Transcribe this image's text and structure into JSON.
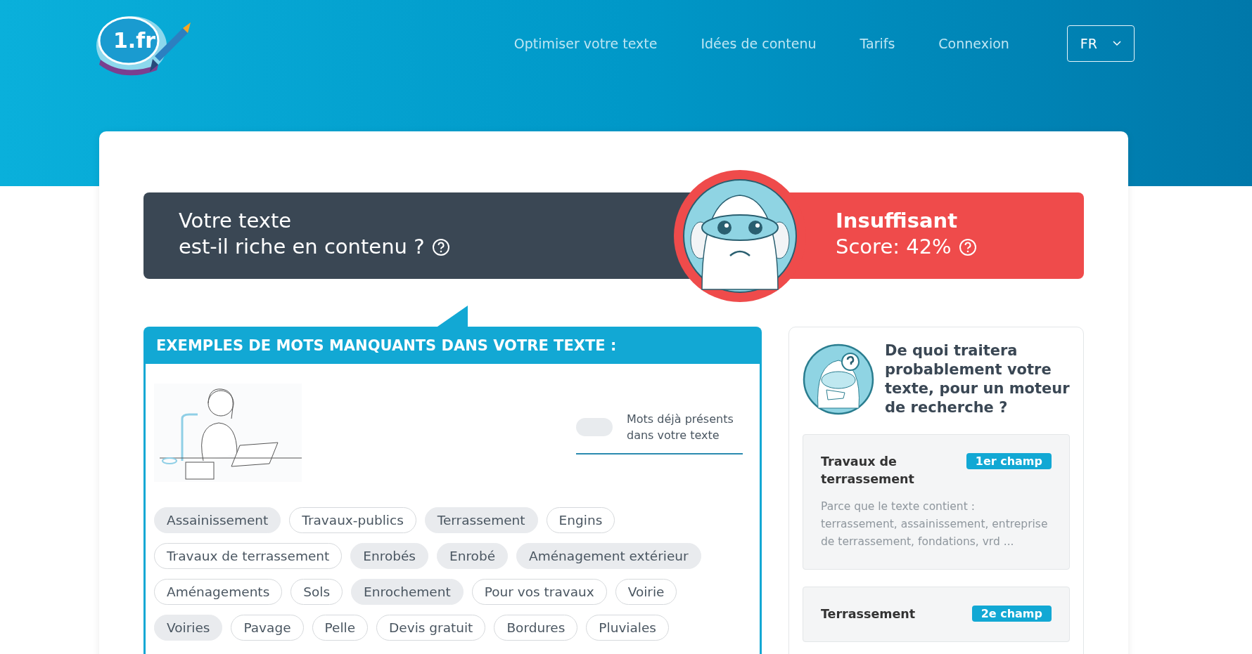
{
  "header": {
    "logo_text": "1.fr",
    "nav": [
      "Optimiser votre texte",
      "Idées de contenu",
      "Tarifs",
      "Connexion"
    ],
    "language": "FR"
  },
  "banner": {
    "question_lines": [
      "Votre texte",
      "est-il riche en contenu ?"
    ],
    "verdict": "Insuffisant",
    "score": "Score: 42%"
  },
  "missing_words": {
    "title": "EXEMPLES DE MOTS MANQUANTS DANS VOTRE TEXTE :",
    "toggle": {
      "label": "Mots déjà présents dans votre texte",
      "on": false
    },
    "tags": [
      {
        "label": "Assainissement",
        "present": true
      },
      {
        "label": "Travaux-publics",
        "present": false
      },
      {
        "label": "Terrassement",
        "present": true
      },
      {
        "label": "Engins",
        "present": false
      },
      {
        "label": "Travaux de terrassement",
        "present": false
      },
      {
        "label": "Enrobés",
        "present": true
      },
      {
        "label": "Enrobé",
        "present": true
      },
      {
        "label": "Aménagement extérieur",
        "present": true
      },
      {
        "label": "Aménagements",
        "present": false
      },
      {
        "label": "Sols",
        "present": false
      },
      {
        "label": "Enrochement",
        "present": true
      },
      {
        "label": "Pour vos travaux",
        "present": false
      },
      {
        "label": "Voirie",
        "present": false
      },
      {
        "label": "Voiries",
        "present": true
      },
      {
        "label": "Pavage",
        "present": false
      },
      {
        "label": "Pelle",
        "present": false
      },
      {
        "label": "Devis gratuit",
        "present": false
      },
      {
        "label": "Bordures",
        "present": false
      },
      {
        "label": "Pluviales",
        "present": false
      }
    ]
  },
  "topics": {
    "title": "De quoi traitera probablement votre texte, pour un moteur de recherche ?",
    "items": [
      {
        "name": "Travaux de terrassement",
        "rank": "1er champ",
        "reason": "Parce que le texte contient : terrassement, assainissement, entreprise de terrassement, fondations, vrd ..."
      },
      {
        "name": "Terrassement",
        "rank": "2e champ"
      }
    ]
  }
}
